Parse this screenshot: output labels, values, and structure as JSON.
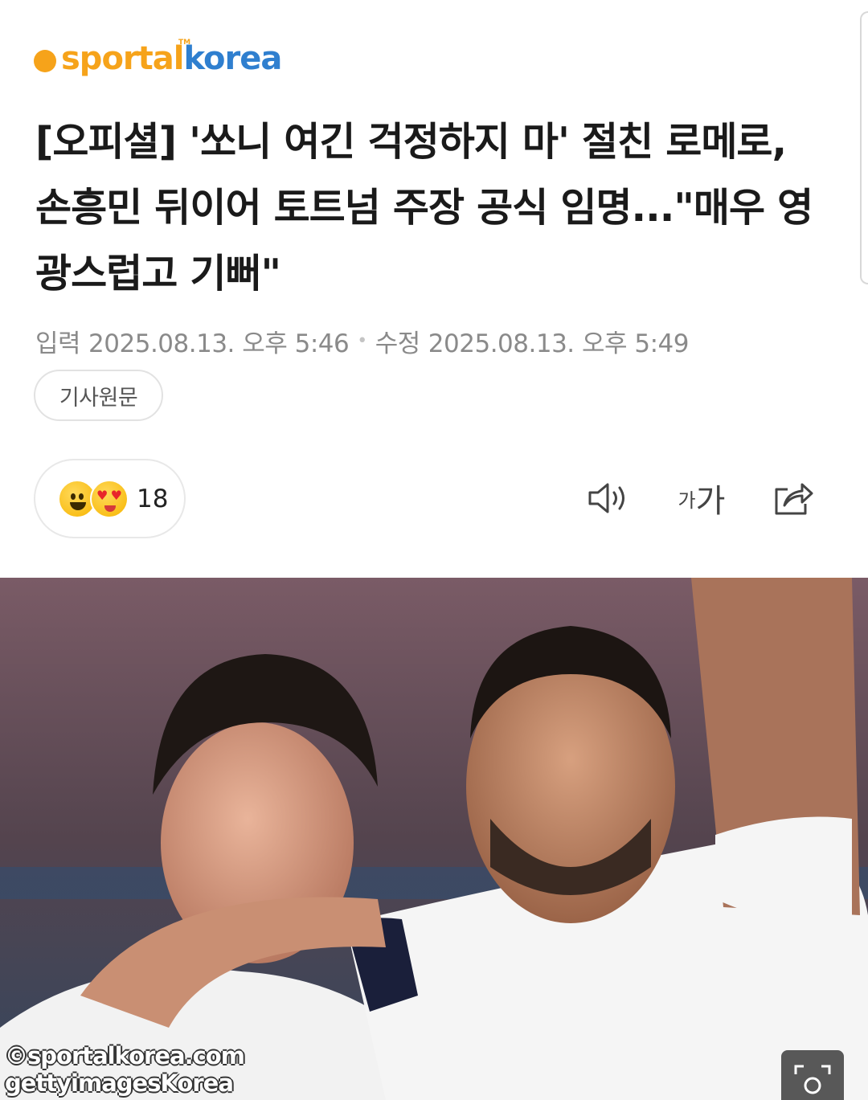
{
  "logo": {
    "part1": "sportal",
    "part2": "korea",
    "tm": "TM"
  },
  "article": {
    "headline": "[오피셜] '쏘니 여긴 걱정하지 마' 절친 로메로, 손흥민 뒤이어 토트넘 주장 공식 임명...\"매우 영광스럽고 기뻐\"",
    "input_label": "입력",
    "input_time": "2025.08.13. 오후 5:46",
    "edit_label": "수정",
    "edit_time": "2025.08.13. 오후 5:49",
    "separator": "•",
    "source_button": "기사원문"
  },
  "reactions": {
    "count": "18"
  },
  "toolbar": {
    "speaker_icon": "speaker-icon",
    "font_small": "가",
    "font_big": "가",
    "share_icon": "share-icon"
  },
  "photo": {
    "credit_line1": "©sportalkorea.com",
    "credit_line2": "gettyimagesKorea"
  },
  "colors": {
    "logo_orange": "#f6a31a",
    "logo_blue": "#2f7fcf"
  }
}
